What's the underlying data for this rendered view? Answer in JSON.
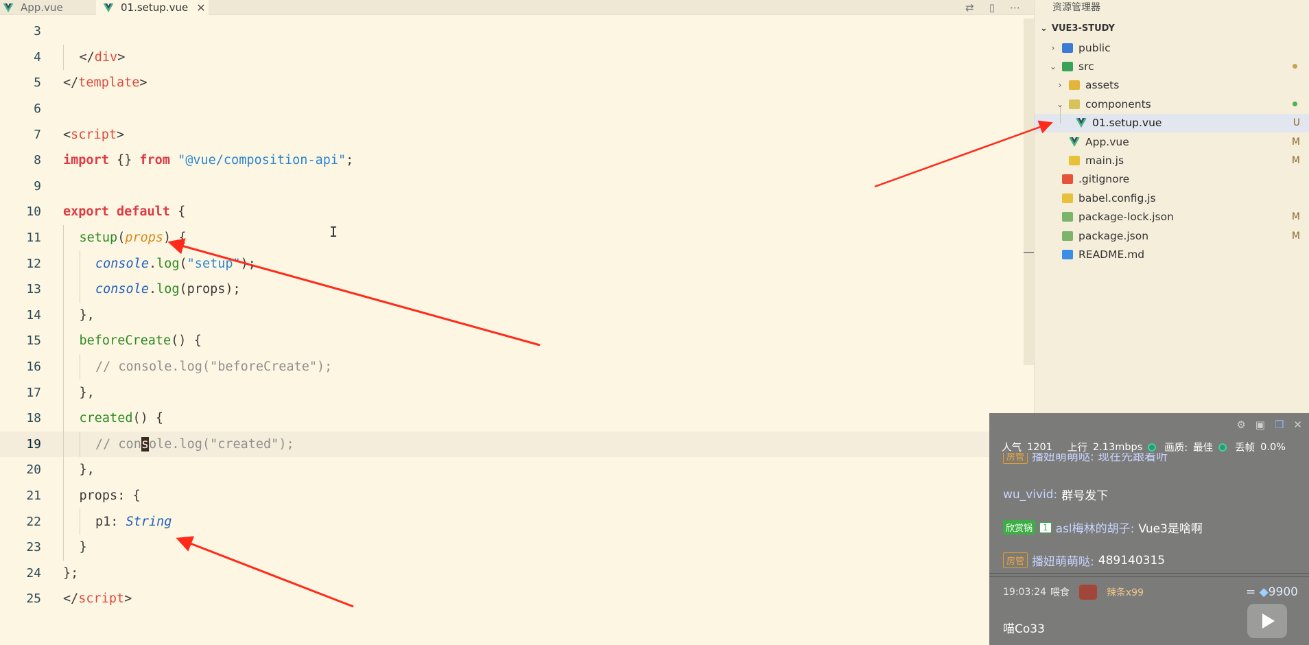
{
  "tabs": [
    {
      "label": "App.vue",
      "active": false
    },
    {
      "label": "01.setup.vue",
      "active": true
    }
  ],
  "tab_close": "✕",
  "editor": {
    "lines": [
      {
        "num": "3",
        "tokens": []
      },
      {
        "num": "4",
        "indent": 1,
        "tokens": [
          [
            "k-pun",
            "</"
          ],
          [
            "k-tag",
            "div"
          ],
          [
            "k-pun",
            ">"
          ]
        ]
      },
      {
        "num": "5",
        "tokens": [
          [
            "k-pun",
            "</"
          ],
          [
            "k-tag",
            "template"
          ],
          [
            "k-pun",
            ">"
          ]
        ]
      },
      {
        "num": "6",
        "tokens": []
      },
      {
        "num": "7",
        "tokens": [
          [
            "k-pun",
            "<"
          ],
          [
            "k-tag",
            "script"
          ],
          [
            "k-pun",
            ">"
          ]
        ]
      },
      {
        "num": "8",
        "tokens": [
          [
            "k-kw",
            "import"
          ],
          [
            "k-pun",
            " {} "
          ],
          [
            "k-kw",
            "from"
          ],
          [
            "k-pun",
            " "
          ],
          [
            "k-str",
            "\"@vue/composition-api\""
          ],
          [
            "k-pun",
            ";"
          ]
        ]
      },
      {
        "num": "9",
        "tokens": []
      },
      {
        "num": "10",
        "tokens": [
          [
            "k-kw",
            "export"
          ],
          [
            "k-pun",
            " "
          ],
          [
            "k-kw",
            "default"
          ],
          [
            "k-pun",
            " {"
          ]
        ]
      },
      {
        "num": "11",
        "indent": 1,
        "tokens": [
          [
            "k-fn",
            "setup"
          ],
          [
            "k-pun",
            "("
          ],
          [
            "k-param",
            "props"
          ],
          [
            "k-pun",
            ") {"
          ]
        ]
      },
      {
        "num": "12",
        "indent": 2,
        "tokens": [
          [
            "k-obj",
            "console"
          ],
          [
            "k-pun",
            "."
          ],
          [
            "k-fn",
            "log"
          ],
          [
            "k-pun",
            "("
          ],
          [
            "k-str",
            "\"setup\""
          ],
          [
            "k-pun",
            ");"
          ]
        ]
      },
      {
        "num": "13",
        "indent": 2,
        "tokens": [
          [
            "k-obj",
            "console"
          ],
          [
            "k-pun",
            "."
          ],
          [
            "k-fn",
            "log"
          ],
          [
            "k-pun",
            "(props);"
          ]
        ]
      },
      {
        "num": "14",
        "indent": 1,
        "tokens": [
          [
            "k-pun",
            "},"
          ]
        ]
      },
      {
        "num": "15",
        "indent": 1,
        "tokens": [
          [
            "k-fn",
            "beforeCreate"
          ],
          [
            "k-pun",
            "() {"
          ]
        ]
      },
      {
        "num": "16",
        "indent": 2,
        "tokens": [
          [
            "k-cmt",
            "// console.log(\"beforeCreate\");"
          ]
        ]
      },
      {
        "num": "17",
        "indent": 1,
        "tokens": [
          [
            "k-pun",
            "},"
          ]
        ]
      },
      {
        "num": "18",
        "indent": 1,
        "tokens": [
          [
            "k-fn",
            "created"
          ],
          [
            "k-pun",
            "() {"
          ]
        ]
      },
      {
        "num": "19",
        "indent": 2,
        "current": true,
        "tokens": [
          [
            "k-cmt",
            "// con"
          ],
          [
            "cursor-box k-cmt",
            "s"
          ],
          [
            "k-cmt",
            "ole.log(\"created\");"
          ]
        ]
      },
      {
        "num": "20",
        "indent": 1,
        "tokens": [
          [
            "k-pun",
            "},"
          ]
        ]
      },
      {
        "num": "21",
        "indent": 1,
        "tokens": [
          [
            "k-pun",
            "props: {"
          ]
        ]
      },
      {
        "num": "22",
        "indent": 2,
        "tokens": [
          [
            "k-pun",
            "p1: "
          ],
          [
            "k-obj",
            "String"
          ]
        ]
      },
      {
        "num": "23",
        "indent": 1,
        "tokens": [
          [
            "k-pun",
            "}"
          ]
        ]
      },
      {
        "num": "24",
        "tokens": [
          [
            "k-pun",
            "};"
          ]
        ]
      },
      {
        "num": "25",
        "tokens": [
          [
            "k-pun",
            "</"
          ],
          [
            "k-tag",
            "script"
          ],
          [
            "k-pun",
            ">"
          ]
        ]
      }
    ],
    "ibeam": "I"
  },
  "explorer": {
    "title": "资源管理器",
    "root": "VUE3-STUDY",
    "items": [
      {
        "label": "public",
        "depth": 1,
        "chev": "›",
        "icon": "#3b7bd6",
        "badge": "",
        "dot": ""
      },
      {
        "label": "src",
        "depth": 1,
        "chev": "⌄",
        "icon": "#3aa35a",
        "badge": "",
        "dot": "#c9a25a"
      },
      {
        "label": "assets",
        "depth": 2,
        "chev": "›",
        "icon": "#e3b53a",
        "badge": "",
        "dot": ""
      },
      {
        "label": "components",
        "depth": 2,
        "chev": "⌄",
        "icon": "#d8c25a",
        "badge": "",
        "dot": "#4caf50"
      },
      {
        "label": "01.setup.vue",
        "depth": 3,
        "chev": "",
        "icon": "vue",
        "badge": "U",
        "dot": "",
        "selected": true
      },
      {
        "label": "App.vue",
        "depth": 2,
        "chev": "",
        "icon": "vue",
        "badge": "M",
        "dot": ""
      },
      {
        "label": "main.js",
        "depth": 2,
        "chev": "",
        "icon": "#e8c13a",
        "badge": "M",
        "dot": ""
      },
      {
        "label": ".gitignore",
        "depth": 1,
        "chev": "",
        "icon": "#e5533a",
        "badge": "",
        "dot": ""
      },
      {
        "label": "babel.config.js",
        "depth": 1,
        "chev": "",
        "icon": "#e8c13a",
        "badge": "",
        "dot": ""
      },
      {
        "label": "package-lock.json",
        "depth": 1,
        "chev": "",
        "icon": "#7db36a",
        "badge": "M",
        "dot": ""
      },
      {
        "label": "package.json",
        "depth": 1,
        "chev": "",
        "icon": "#7db36a",
        "badge": "M",
        "dot": ""
      },
      {
        "label": "README.md",
        "depth": 1,
        "chev": "",
        "icon": "#3a8ee6",
        "badge": "",
        "dot": ""
      }
    ]
  },
  "chat": {
    "stats": {
      "popularity_label": "人气",
      "popularity": "1201",
      "upload_label": "上行",
      "upload": "2.13mbps",
      "quality_label": "画质:",
      "quality": "最佳",
      "drop_label": "丢帧",
      "drop": "0.0%"
    },
    "partial_line": "播妞萌萌哒: 现在先跟着听",
    "partial_tag": "房管",
    "messages": [
      {
        "user": "wu_vivid:",
        "text": "群号发下",
        "tags": []
      },
      {
        "user": "asl梅林的胡子:",
        "text": "Vue3是啥啊",
        "tags": [
          "欣赏锅",
          "1"
        ]
      },
      {
        "user": "播妞萌萌哒:",
        "text": "489140315",
        "tags": [
          "房管"
        ]
      }
    ],
    "gift": {
      "time": "19:03:24",
      "action": "喂食",
      "name": "辣条x99",
      "price": "9900",
      "price_prefix": "="
    },
    "bottom_user": "喵Co33"
  }
}
